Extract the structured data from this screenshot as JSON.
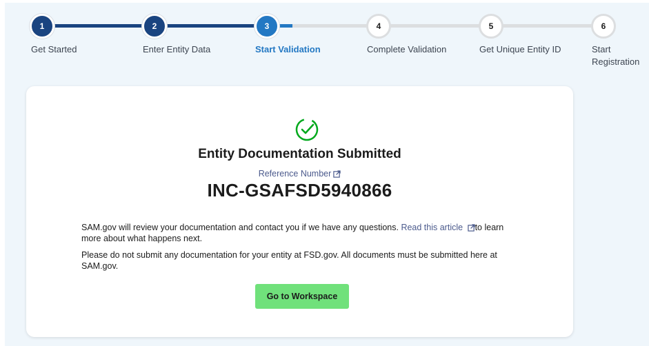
{
  "stepper": {
    "steps": [
      {
        "number": "1",
        "label": "Get Started",
        "state": "done"
      },
      {
        "number": "2",
        "label": "Enter Entity Data",
        "state": "done"
      },
      {
        "number": "3",
        "label": "Start Validation",
        "state": "current"
      },
      {
        "number": "4",
        "label": "Complete Validation",
        "state": "todo"
      },
      {
        "number": "5",
        "label": "Get Unique Entity ID",
        "state": "todo"
      },
      {
        "number": "6",
        "label": "Start Registration",
        "state": "todo"
      }
    ]
  },
  "card": {
    "icon": "check-circle-icon",
    "title": "Entity Documentation Submitted",
    "reference_label": "Reference Number",
    "reference_number": "INC-GSAFSD5940866",
    "paragraph1_text": "SAM.gov will review your documentation and contact you if we have any questions.",
    "paragraph1_link": "Read this article",
    "paragraph1_tail": "to learn more about what happens next.",
    "paragraph2": "Please do not submit any documentation for your entity at FSD.gov. All documents must be submitted here at SAM.gov.",
    "button_label": "Go to Workspace"
  },
  "colors": {
    "background": "#eff6fb",
    "step_done": "#1a4480",
    "step_current": "#2378c3",
    "step_todo_track": "#dcdee0",
    "success_green": "#00a91c",
    "button_green": "#70e17b",
    "link": "#4b5a8c"
  }
}
